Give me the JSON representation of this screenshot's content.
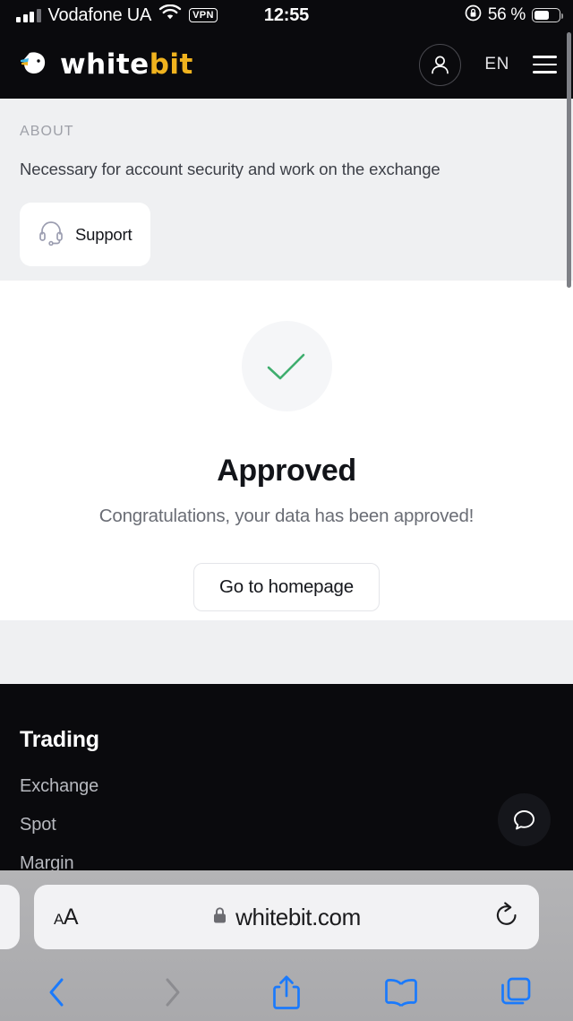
{
  "status_bar": {
    "carrier": "Vodafone UA",
    "vpn_badge": "VPN",
    "time": "12:55",
    "battery_percent": "56 %",
    "icons": {
      "signal": "cellular-signal-icon",
      "wifi": "wifi-icon",
      "rotation_lock": "rotation-lock-icon",
      "battery": "battery-icon"
    }
  },
  "header": {
    "logo_white": "white",
    "logo_accent": "bit",
    "logo_accent_color": "#f0b31e",
    "language": "EN",
    "icons": {
      "logo_mark": "whitebit-whale-logo-icon",
      "account": "user-account-icon",
      "menu": "hamburger-menu-icon"
    }
  },
  "about": {
    "label": "ABOUT",
    "description": "Necessary for account security and work on the exchange",
    "support_label": "Support",
    "support_icon": "headset-icon"
  },
  "result": {
    "icon": "check-mark-icon",
    "check_color": "#3fae6e",
    "title": "Approved",
    "subtitle": "Congratulations, your data has been approved!",
    "button_label": "Go to homepage"
  },
  "footer": {
    "title": "Trading",
    "links": [
      "Exchange",
      "Spot",
      "Margin"
    ],
    "chat_icon": "chat-bubble-icon"
  },
  "browser": {
    "text_size_small": "A",
    "text_size_big": "A",
    "url": "whitebit.com",
    "lock_icon": "lock-icon",
    "reload_icon": "reload-icon",
    "toolbar": {
      "back": "back-chevron-icon",
      "forward": "forward-chevron-icon",
      "share": "share-icon",
      "bookmarks": "bookmarks-book-icon",
      "tabs": "tabs-icon"
    }
  }
}
